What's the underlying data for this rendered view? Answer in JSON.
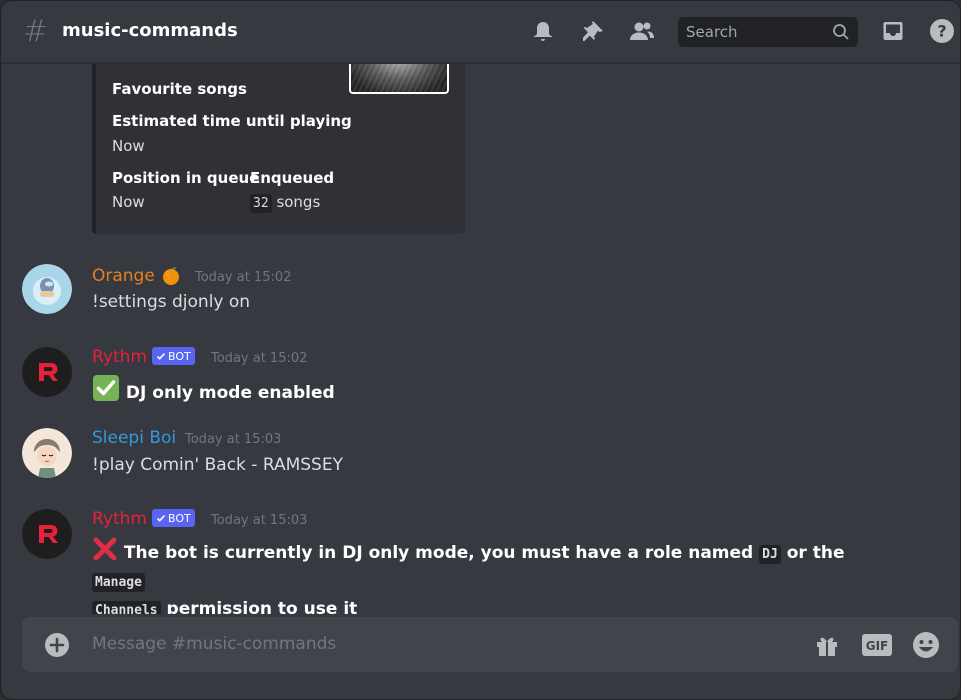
{
  "header": {
    "hash_symbol": "#",
    "channel_name": "music-commands",
    "search_placeholder": "Search"
  },
  "embed": {
    "fields": [
      {
        "name": "Favourite songs",
        "value": ""
      },
      {
        "name": "Estimated time until playing",
        "value": "Now"
      },
      {
        "name": "Position in queue",
        "value": "Now"
      },
      {
        "name": "Enqueued",
        "value_code": "32",
        "value_suffix": "songs"
      }
    ]
  },
  "messages": [
    {
      "username": "Orange",
      "username_color": "#e67e22",
      "emoji": "orange",
      "timestamp": "Today at 15:02",
      "content": "!settings djonly on",
      "bot": false
    },
    {
      "username": "Rythm",
      "username_color": "#e6213c",
      "bot": true,
      "bot_label": "BOT",
      "timestamp": "Today at 15:02",
      "content_icon": "check-mark-icon",
      "content": "DJ only mode enabled"
    },
    {
      "username": "Sleepi Boi",
      "username_color": "#3498db",
      "timestamp": "Today at 15:03",
      "content": "!play Comin' Back - RAMSSEY",
      "bot": false
    },
    {
      "username": "Rythm",
      "username_color": "#e6213c",
      "bot": true,
      "bot_label": "BOT",
      "timestamp": "Today at 15:03",
      "content_icon": "cross-mark-icon",
      "content_part1": "The bot is currently in DJ only mode, you must have a role named",
      "code1": "DJ",
      "content_part2": "or the",
      "code2a": "Manage",
      "code2b": "Channels",
      "content_part3": "permission to use it"
    }
  ],
  "composer": {
    "placeholder": "Message #music-commands",
    "gif_label": "GIF"
  },
  "colors": {
    "background": "#36393f",
    "embed_bg": "#2f3136",
    "bot_tag": "#5865f2",
    "muted_text": "#72767d"
  }
}
